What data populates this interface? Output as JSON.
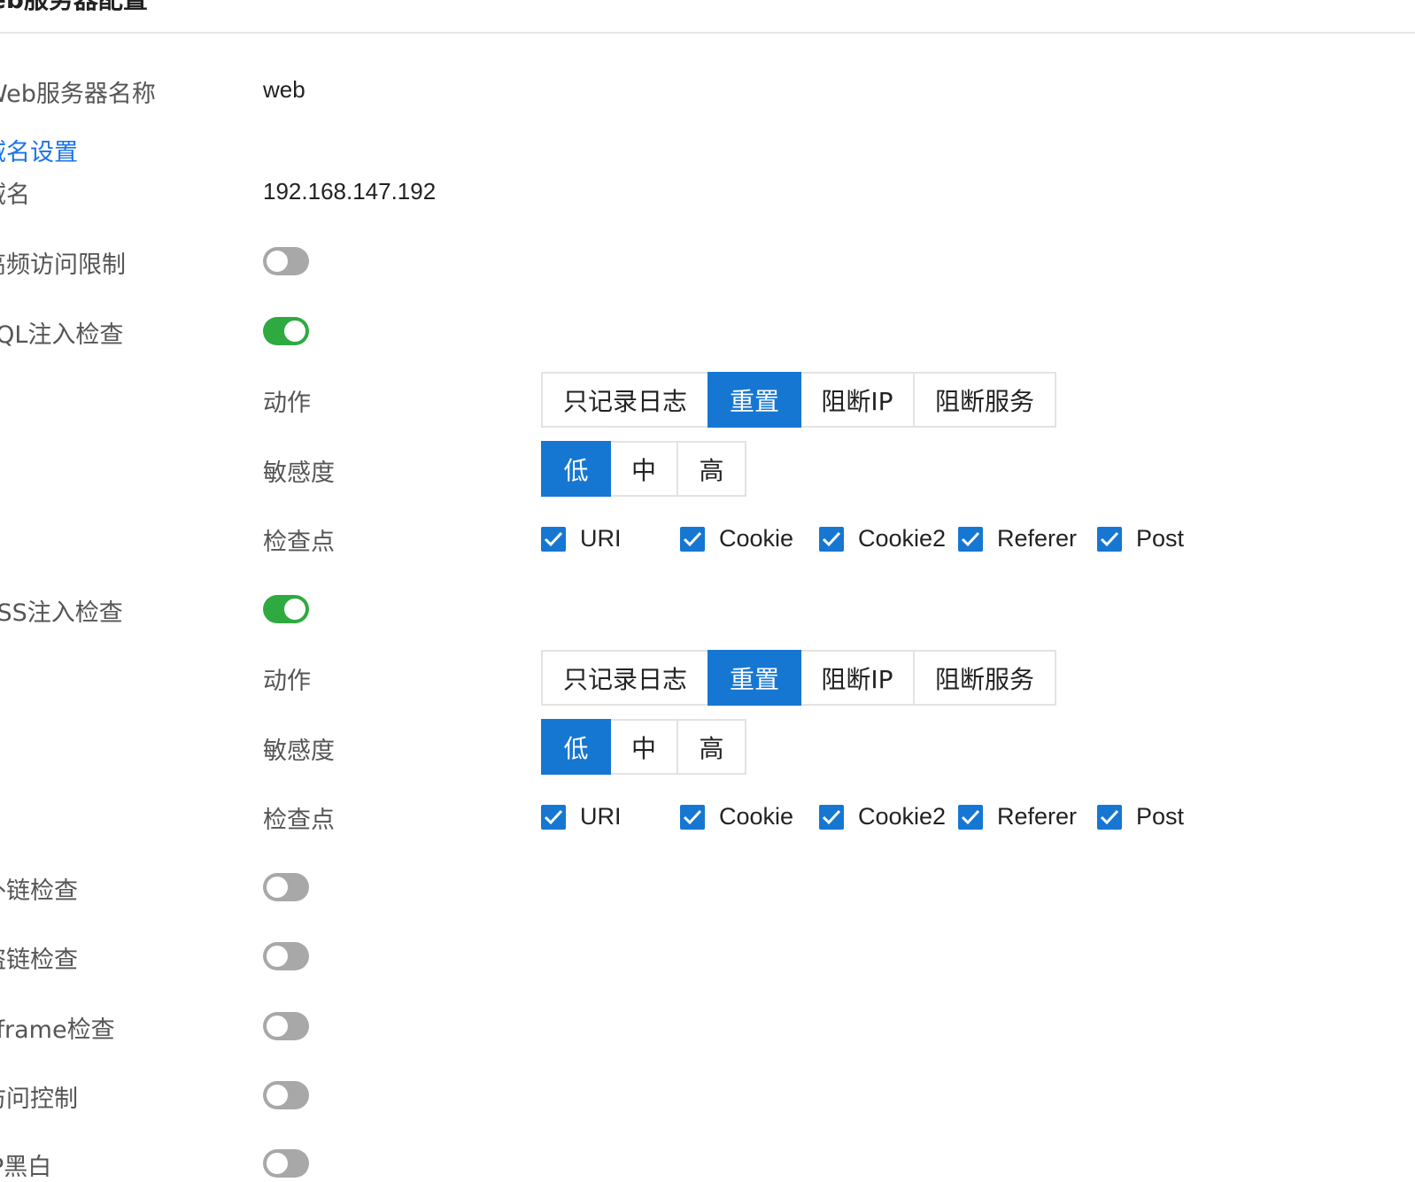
{
  "page": {
    "title": "Web服务器配置"
  },
  "server_name": {
    "label": "Web服务器名称",
    "value": "web"
  },
  "domain_section": {
    "link": "域名设置",
    "domain_label": "域名",
    "domain_value": "192.168.147.192"
  },
  "rows": {
    "rate_limit": {
      "label": "高频访问限制",
      "enabled": false
    },
    "sql": {
      "label": "SQL注入检查",
      "enabled": true
    },
    "xss": {
      "label": "XSS注入检查",
      "enabled": true
    },
    "outlink": {
      "label": "外链检查",
      "enabled": false
    },
    "hotlink": {
      "label": "盗链检查",
      "enabled": false
    },
    "iframe": {
      "label": "iframe检查",
      "enabled": false
    },
    "access": {
      "label": "访问控制",
      "enabled": false
    },
    "last": {
      "label": "IP黑白",
      "enabled": false
    }
  },
  "sql_settings": {
    "action_label": "动作",
    "actions": [
      "只记录日志",
      "重置",
      "阻断IP",
      "阻断服务"
    ],
    "action_selected": "重置",
    "sensitivity_label": "敏感度",
    "sensitivities": [
      "低",
      "中",
      "高"
    ],
    "sensitivity_selected": "低",
    "checkpoints_label": "检查点",
    "checkpoints": [
      {
        "label": "URI",
        "checked": true
      },
      {
        "label": "Cookie",
        "checked": true
      },
      {
        "label": "Cookie2",
        "checked": true
      },
      {
        "label": "Referer",
        "checked": true
      },
      {
        "label": "Post",
        "checked": true
      }
    ]
  },
  "xss_settings": {
    "action_label": "动作",
    "actions": [
      "只记录日志",
      "重置",
      "阻断IP",
      "阻断服务"
    ],
    "action_selected": "重置",
    "sensitivity_label": "敏感度",
    "sensitivities": [
      "低",
      "中",
      "高"
    ],
    "sensitivity_selected": "低",
    "checkpoints_label": "检查点",
    "checkpoints": [
      {
        "label": "URI",
        "checked": true
      },
      {
        "label": "Cookie",
        "checked": true
      },
      {
        "label": "Cookie2",
        "checked": true
      },
      {
        "label": "Referer",
        "checked": true
      },
      {
        "label": "Post",
        "checked": true
      }
    ]
  },
  "colors": {
    "accent": "#1677d2",
    "toggle_on": "#2eaa40",
    "toggle_off": "#a8a8a8",
    "link": "#1a73e8"
  }
}
